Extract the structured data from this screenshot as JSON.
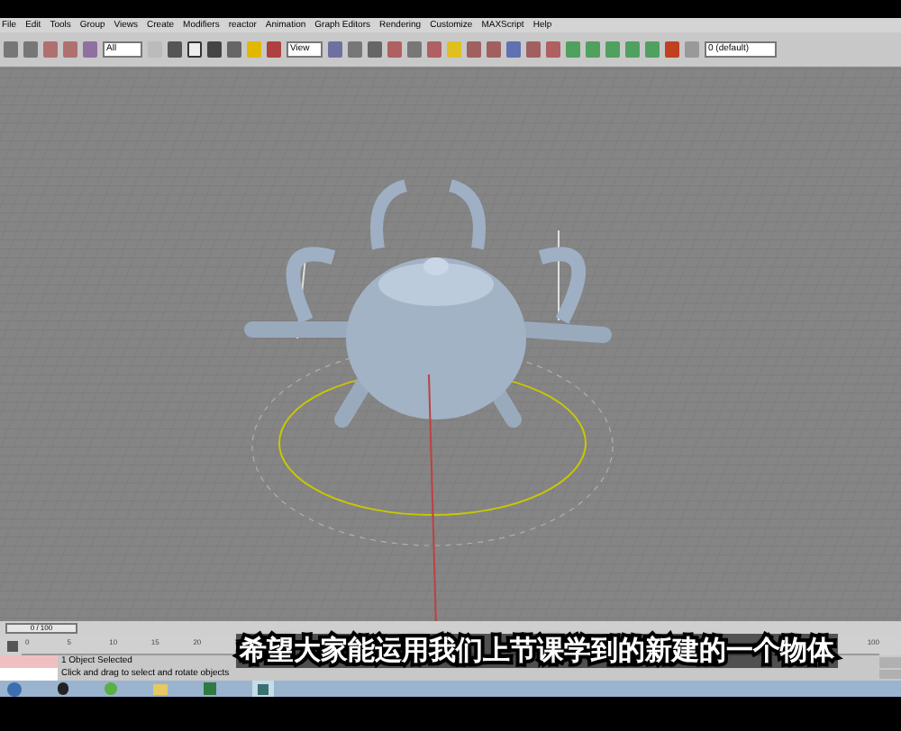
{
  "menu": [
    "File",
    "Edit",
    "Tools",
    "Group",
    "Views",
    "Create",
    "Modifiers",
    "reactor",
    "Animation",
    "Graph Editors",
    "Rendering",
    "Customize",
    "MAXScript",
    "Help"
  ],
  "toolbar": {
    "selection_filter": "All",
    "reference_coord": "View",
    "layer": "0 (default)"
  },
  "time_slider": {
    "position": "0 / 100",
    "level": 0
  },
  "track_ticks": [
    "0",
    "5",
    "10",
    "15",
    "20"
  ],
  "track_end_tick": "100",
  "status": {
    "selection": "1 Object Selected",
    "prompt": "Click and drag to select and rotate objects"
  },
  "subtitle": "希望大家能运用我们上节课学到的新建的一个物体"
}
